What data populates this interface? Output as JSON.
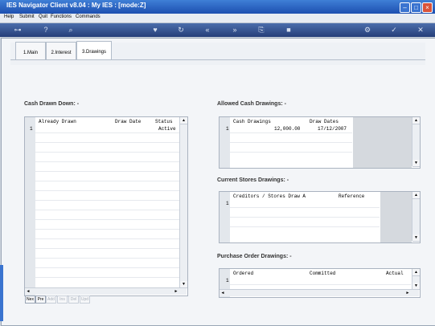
{
  "window": {
    "title": "IES Navigator Client v8.04 : My IES :      [mode:Z]"
  },
  "menu": [
    "Help",
    "Submit",
    "Quit",
    "Functions",
    "Commands"
  ],
  "toolbar": {
    "icons": [
      "key-icon",
      "help-icon",
      "search-icon",
      "heart-icon",
      "refresh-icon",
      "rewind-icon",
      "forward-icon",
      "copy-icon",
      "stop-icon",
      "gear-icon",
      "check-icon",
      "close-icon"
    ]
  },
  "tabs": [
    {
      "label": "1.Main"
    },
    {
      "label": "2.Interest"
    },
    {
      "label": "3.Drawings"
    }
  ],
  "cash_drawn_down": {
    "title": "Cash Drawn Down: -",
    "columns": [
      "Already Drawn",
      "Draw Date",
      "Status"
    ],
    "rows": [
      {
        "num": "1",
        "already_drawn": "",
        "draw_date": "",
        "status": "Active"
      }
    ]
  },
  "allowed_cash": {
    "title": "Allowed Cash Drawings: -",
    "columns": [
      "Cash Drawings",
      "Draw Dates"
    ],
    "rows": [
      {
        "num": "1",
        "cash_drawings": "12,000.00",
        "draw_dates": "17/12/2007"
      }
    ]
  },
  "current_stores": {
    "title": "Current Stores Drawings: -",
    "columns": [
      "Creditors / Stores Draw A",
      "Reference"
    ],
    "rows": [
      {
        "num": "1"
      }
    ]
  },
  "purchase_orders": {
    "title": "Purchase Order Drawings: -",
    "columns": [
      "Ordered",
      "Committed",
      "Actual"
    ],
    "rows": [
      {
        "num": "1"
      }
    ]
  },
  "nav_buttons": [
    {
      "label": "Nex",
      "enabled": true
    },
    {
      "label": "Pre",
      "enabled": true
    },
    {
      "label": "Add",
      "enabled": false
    },
    {
      "label": "Ins",
      "enabled": false
    },
    {
      "label": "Del",
      "enabled": false
    },
    {
      "label": "Upd",
      "enabled": false
    }
  ],
  "colors": {
    "titlebar": "#1d4fb0",
    "toolbar": "#253e78",
    "background": "#f3f5f8"
  }
}
